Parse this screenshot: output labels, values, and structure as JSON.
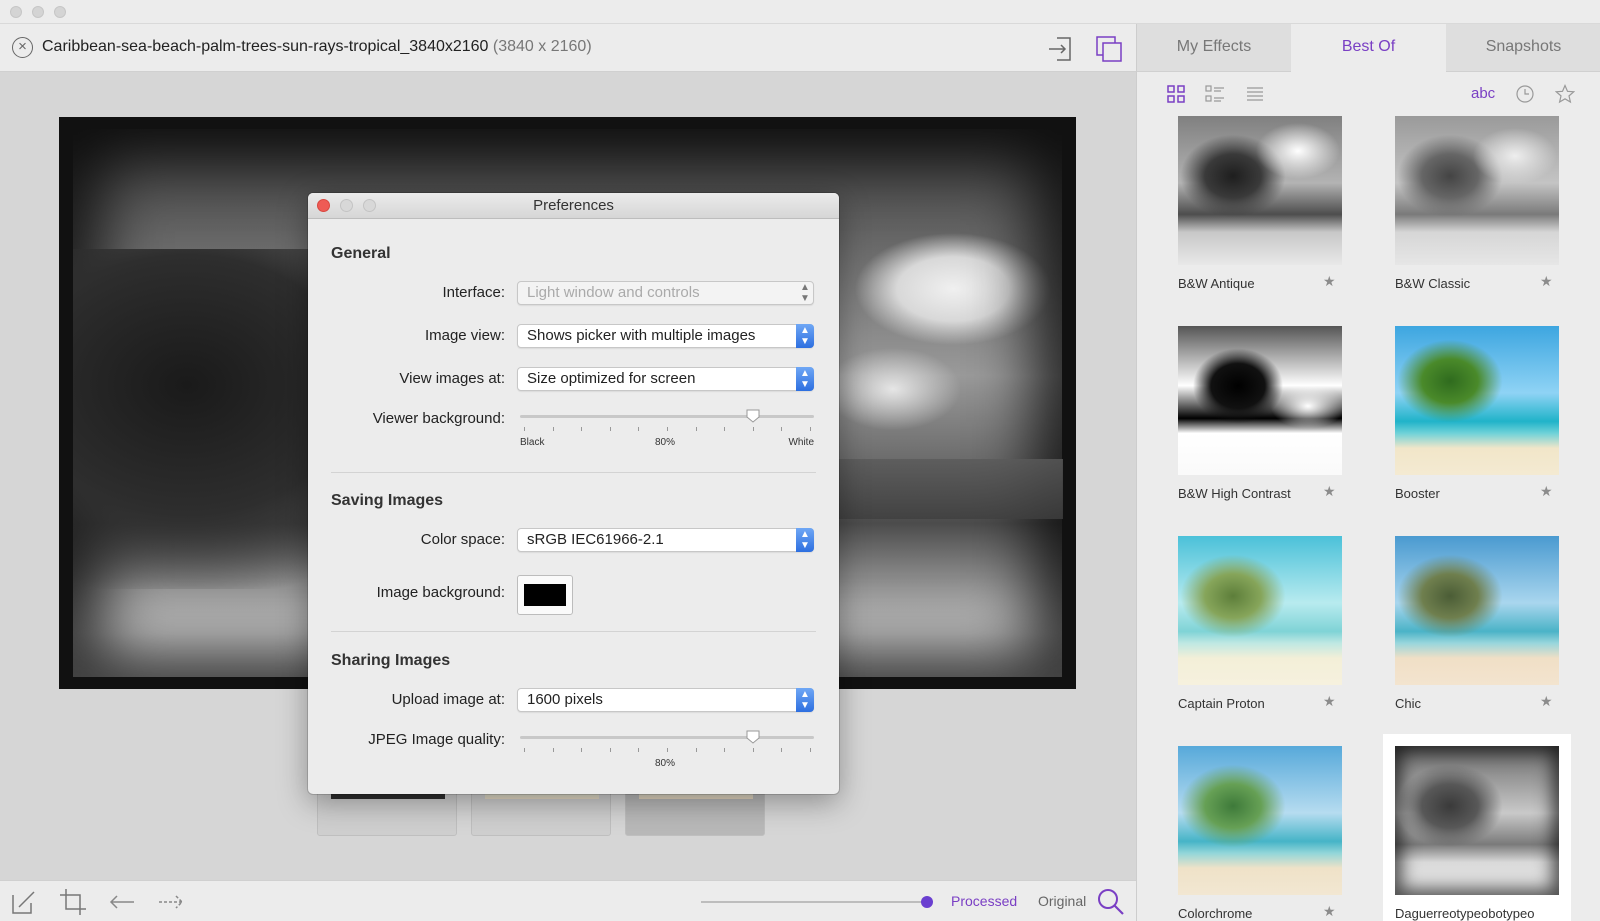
{
  "window": {
    "title": ""
  },
  "file": {
    "name": "Caribbean-sea-beach-palm-trees-sun-rays-tropical_3840x2160",
    "dimensions": "(3840 x 2160)"
  },
  "bottombar": {
    "processed_label": "Processed",
    "original_label": "Original",
    "compare_position": 1.0
  },
  "panel": {
    "tabs": [
      {
        "label": "My Effects",
        "active": false
      },
      {
        "label": "Best Of",
        "active": true
      },
      {
        "label": "Snapshots",
        "active": false
      }
    ],
    "sort_label": "abc",
    "effects": [
      {
        "label": "B&W Antique"
      },
      {
        "label": "B&W Classic"
      },
      {
        "label": "B&W High Contrast"
      },
      {
        "label": "Booster"
      },
      {
        "label": "Captain Proton"
      },
      {
        "label": "Chic"
      },
      {
        "label": "Colorchrome"
      },
      {
        "label": "Daguerreotypeobotypeo",
        "selected": true
      }
    ]
  },
  "preferences": {
    "title": "Preferences",
    "general": {
      "heading": "General",
      "interface_label": "Interface:",
      "interface_value": "Light window and controls",
      "image_view_label": "Image view:",
      "image_view_value": "Shows picker with multiple images",
      "view_at_label": "View images at:",
      "view_at_value": "Size optimized for screen",
      "viewer_bg_label": "Viewer background:",
      "viewer_bg_value": 0.8,
      "viewer_bg_min": "Black",
      "viewer_bg_mid": "80%",
      "viewer_bg_max": "White"
    },
    "saving": {
      "heading": "Saving Images",
      "color_space_label": "Color space:",
      "color_space_value": "sRGB IEC61966-2.1",
      "image_bg_label": "Image background:",
      "image_bg_color": "#000000"
    },
    "sharing": {
      "heading": "Sharing Images",
      "upload_label": "Upload image at:",
      "upload_value": "1600 pixels",
      "jpeg_label": "JPEG Image quality:",
      "jpeg_value": 0.8,
      "jpeg_mid": "80%"
    }
  },
  "colors": {
    "accent": "#7a3fc4",
    "close_red": "#ee5b55"
  }
}
